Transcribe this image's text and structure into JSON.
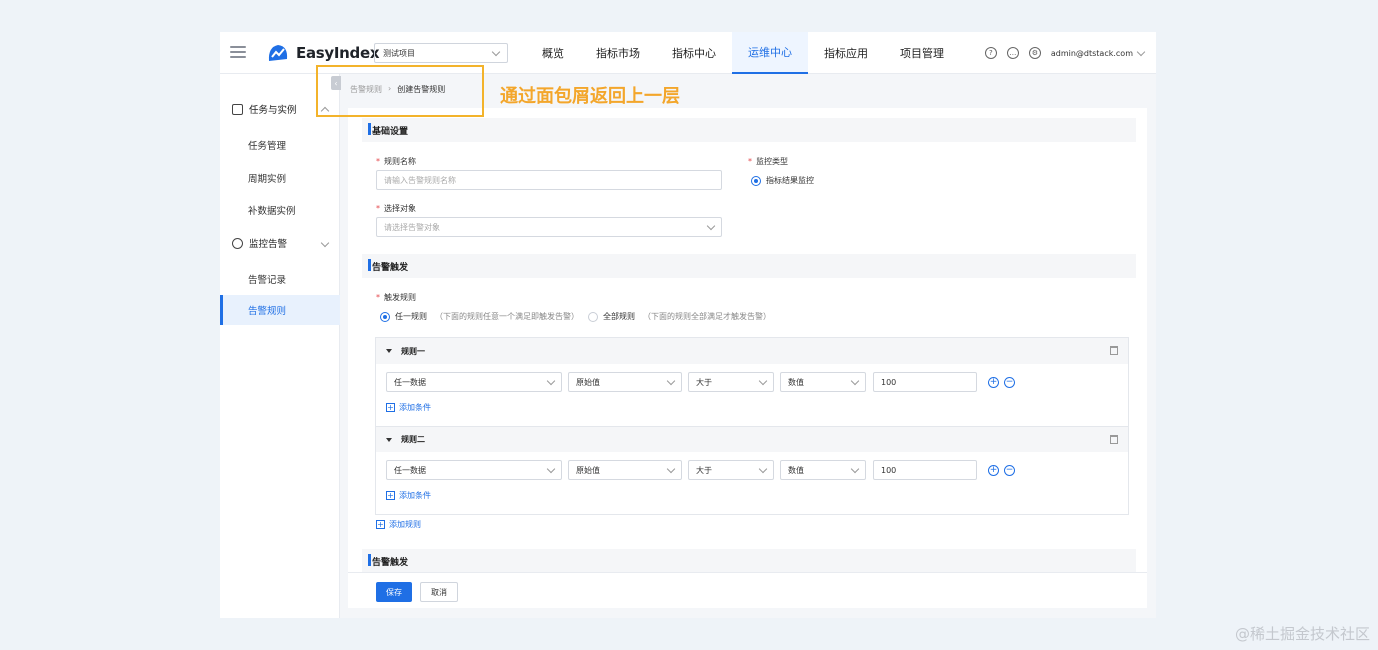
{
  "header": {
    "logo_text": "EasyIndex",
    "project_select": "测试项目",
    "nav": [
      "概览",
      "指标市场",
      "指标中心",
      "运维中心",
      "指标应用",
      "项目管理"
    ],
    "active_nav": 3,
    "user": "admin@dtstack.com"
  },
  "sidebar": {
    "groups": [
      {
        "label": "任务与实例",
        "items": [
          "任务管理",
          "周期实例",
          "补数据实例"
        ]
      },
      {
        "label": "监控告警",
        "items": [
          "告警记录",
          "告警规则"
        ]
      }
    ],
    "collapse_glyph": "‹"
  },
  "breadcrumb": {
    "parent": "告警规则",
    "separator": "›",
    "current": "创建告警规则"
  },
  "annotation": "通过面包屑返回上一层",
  "basic": {
    "title": "基础设置",
    "required_mark": "*",
    "rule_name_label": "规则名称",
    "rule_name_placeholder": "请输入告警规则名称",
    "monitor_type_label": "监控类型",
    "monitor_type_option": "指标结果监控",
    "target_label": "选择对象",
    "target_placeholder": "请选择告警对象"
  },
  "trigger": {
    "title": "告警触发",
    "rule_label": "触发规则",
    "option_any": "任一规则",
    "option_any_hint": "（下面的规则任意一个满足即触发告警）",
    "option_all": "全部规则",
    "option_all_hint": "（下面的规则全部满足才触发告警）",
    "rules": [
      {
        "name": "规则一",
        "data": "任一数据",
        "metric": "原始值",
        "op": "大于",
        "kind": "数值",
        "value": "100",
        "add_condition": "添加条件"
      },
      {
        "name": "规则二",
        "data": "任一数据",
        "metric": "原始值",
        "op": "大于",
        "kind": "数值",
        "value": "100",
        "add_condition": "添加条件"
      }
    ],
    "add_rule": "添加规则"
  },
  "section3_title": "告警触发",
  "buttons": {
    "save": "保存",
    "cancel": "取消"
  },
  "watermark": "@稀土掘金技术社区",
  "colors": {
    "accent": "#1f6fe5",
    "annotation": "#f3a62b"
  }
}
